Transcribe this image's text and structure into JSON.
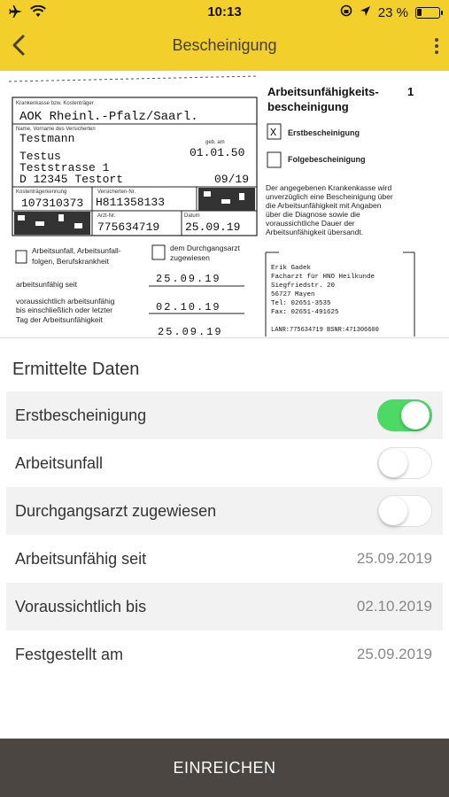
{
  "status_bar": {
    "time": "10:13",
    "battery_text": "23 %",
    "battery_level": 0.23,
    "icons": [
      "airplane-icon",
      "wifi-icon",
      "lock-rotation-icon",
      "location-icon"
    ]
  },
  "nav": {
    "title": "Bescheinigung",
    "back_icon": "chevron-left-icon",
    "more_icon": "more-vertical-icon"
  },
  "document": {
    "insurance_label": "Krankenkasse bzw. Kostenträger",
    "insurance": "AOK Rheinl.-Pfalz/Saarl.",
    "name_label": "Name, Vorname des Versicherten",
    "last_name": "Testmann",
    "first_name": "Testus",
    "dob_label": "geb. am",
    "dob": "01.01.50",
    "street": "Teststrasse 1",
    "city": "D 12345 Testort",
    "valid": "09/19",
    "kk_id_label": "Kostenträgerkennung",
    "kk_id": "107310373",
    "insured_no_label": "Versicherten-Nr.",
    "insured_no": "H811358133",
    "doctor_no_label": "Arzt-Nr.",
    "doctor_no": "775634719",
    "date_label": "Datum",
    "date": "25.09.19",
    "title_line1": "Arbeitsunfähigkeits-",
    "title_line2": "bescheinigung",
    "copy_number": "1",
    "erst_mark": "X",
    "erst_label": "Erstbescheinigung",
    "folge_label": "Folgebescheinigung",
    "notice": [
      "Der angegebenen Krankenkasse wird",
      "unverzüglich eine Bescheinigung über",
      "die Arbeitsunfähigkeit mit Angaben",
      "über die Diagnose sowie die",
      "voraussichtliche Dauer der",
      "Arbeitsunfähigkeit übersandt."
    ],
    "accident_label": [
      "Arbeitsunfall, Arbeitsunfall-",
      "folgen, Berufskrankheit"
    ],
    "durchgang_label": [
      "dem Durchgangsarzt",
      "zugewiesen"
    ],
    "unable_since_label": "arbeitsunfähig seit",
    "unable_since": "25.09.19",
    "expected_label": [
      "voraussichtlich arbeitsunfähig",
      "bis einschließlich oder letzter",
      "Tag der Arbeitsunfähigkeit"
    ],
    "expected": "02.10.19",
    "determined": "25.09.19",
    "doctor_stamp": [
      "Erik Gadek",
      "Facharzt für HNO Heilkunde",
      "Siegfriedstr. 20",
      "56727 Mayen",
      "Tel: 02651-3535",
      "Fax: 02651-491625",
      "",
      "LANR:775634719 BSNR:471306600"
    ]
  },
  "results": {
    "title": "Ermittelte Daten",
    "toggles": [
      {
        "label": "Erstbescheinigung",
        "on": true
      },
      {
        "label": "Arbeitsunfall",
        "on": false
      },
      {
        "label": "Durchgangsarzt zugewiesen",
        "on": false
      }
    ],
    "fields": [
      {
        "label": "Arbeitsunfähig seit",
        "value": "25.09.2019"
      },
      {
        "label": "Voraussichtlich bis",
        "value": "02.10.2019"
      },
      {
        "label": "Festgestellt am",
        "value": "25.09.2019"
      }
    ]
  },
  "submit_label": "EINREICHEN",
  "colors": {
    "accent": "#f3cf2b",
    "toggle_on": "#4cd964",
    "submit_bg": "#4b4642"
  }
}
